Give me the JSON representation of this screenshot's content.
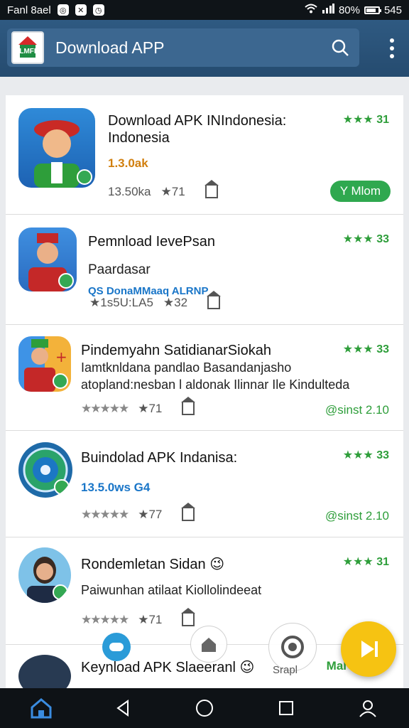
{
  "status_bar": {
    "carrier": "Fanl 8ael",
    "battery_level": 0.8,
    "battery_percent": "80%",
    "time": "545"
  },
  "app_bar": {
    "title": "Download APP",
    "logo_text": "LMFI"
  },
  "items": [
    {
      "name": "Download APK INIndonesia:\nIndonesia",
      "rating": "★★★ 31",
      "price": "1.3.0ak",
      "downloads": "13.50ka",
      "stars_count": "★71",
      "install_label": "Y Mlom"
    },
    {
      "name": "Pemnload IevePsan",
      "rating": "★★★ 33",
      "desc": "Paardasar",
      "price": "QS DonaMMaaq ALRNP",
      "downloads": "★1s5U:LA5",
      "stars_count": "★32"
    },
    {
      "name": "Pindemyahn SatidianarSiokah",
      "rating": "★★★ 33",
      "desc": "Iamtknldana pandlao Basandanjasho\natopland:nesban l aldonak Ilinnar Ile Kindulteda",
      "downloads": "★★★★★",
      "stars_count": "★71",
      "side_text": "@sinst 2.10"
    },
    {
      "name": "Buindolad APK Indanisa:",
      "rating": "★★★ 33",
      "price": "13.5.0ws G4",
      "downloads": "★★★★★",
      "stars_count": "★77",
      "side_text": "@sinst 2.10"
    },
    {
      "name": "Rondemletan Sidan 😉",
      "rating": "★★★ 31",
      "desc": "Paiwunhan atilaat Kiollolindeeat",
      "downloads": "★★★★★",
      "stars_count": "★71"
    },
    {
      "name": "Keynload APK Slaeeranl 😉",
      "side_text": "Mal"
    }
  ],
  "fab_labels": {
    "sapl": "Srapl"
  },
  "colors": {
    "app_bar": "#2f5a82",
    "accent_green": "#2fa84f",
    "fab": "#f6c312"
  }
}
